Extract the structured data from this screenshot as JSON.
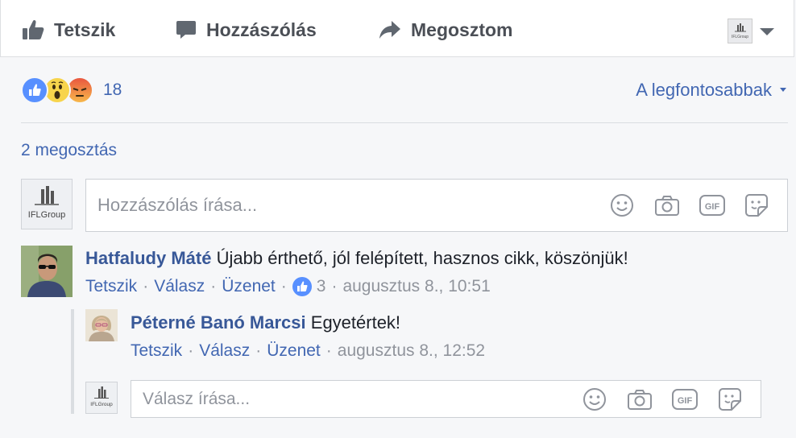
{
  "actions": {
    "like": "Tetszik",
    "comment": "Hozzászólás",
    "share": "Megosztom"
  },
  "page_avatar_text": "IFLGroup",
  "reactions": {
    "icons": [
      "like-icon",
      "wow-icon",
      "angry-icon"
    ],
    "count": "18",
    "sort_label": "A legfontosabbak"
  },
  "shares": "2 megosztás",
  "composer": {
    "placeholder": "Hozzászólás írása...",
    "tools": [
      "emoji-icon",
      "camera-icon",
      "gif-icon",
      "sticker-icon"
    ]
  },
  "comments": [
    {
      "author": "Hatfaludy Máté",
      "text": "Újabb érthető, jól felépített, hasznos cikk, köszönjük!",
      "like": "Tetszik",
      "reply": "Válasz",
      "message": "Üzenet",
      "likes": "3",
      "time": "augusztus 8., 10:51",
      "replies": [
        {
          "author": "Péterné Banó Marcsi",
          "text": "Egyetértek!",
          "like": "Tetszik",
          "reply": "Válasz",
          "message": "Üzenet",
          "time": "augusztus 8., 12:52"
        }
      ]
    }
  ],
  "reply_composer": {
    "placeholder": "Válasz írása..."
  },
  "colors": {
    "link": "#4267b2",
    "name": "#385898",
    "muted": "#90949c",
    "background": "#f6f7f9"
  }
}
